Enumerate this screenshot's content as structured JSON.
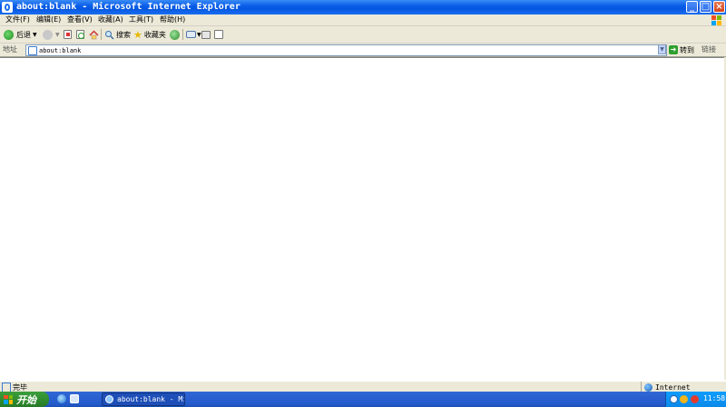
{
  "window": {
    "title": "about:blank - Microsoft Internet Explorer",
    "controls": {
      "minimize": "_",
      "maximize": "□",
      "close": "×"
    }
  },
  "menu": [
    {
      "label": "文件(F)"
    },
    {
      "label": "编辑(E)"
    },
    {
      "label": "查看(V)"
    },
    {
      "label": "收藏(A)"
    },
    {
      "label": "工具(T)"
    },
    {
      "label": "帮助(H)"
    }
  ],
  "toolbar": {
    "back_label": "后退",
    "search_label": "搜索",
    "favorites_label": "收藏夹"
  },
  "address": {
    "label": "地址",
    "value": "about:blank",
    "go_label": "转到",
    "links_label": "链接"
  },
  "status": {
    "text": "完毕",
    "zone": "Internet"
  },
  "taskbar": {
    "start_label": "开始",
    "task_label": "about:blank - Mi...",
    "clock": "11:58"
  },
  "colors": {
    "titlebar": "#0a5ee8",
    "chrome": "#ece9d8",
    "start": "#2e8a2e",
    "taskbar": "#245ccc",
    "tray": "#0f9dff"
  }
}
